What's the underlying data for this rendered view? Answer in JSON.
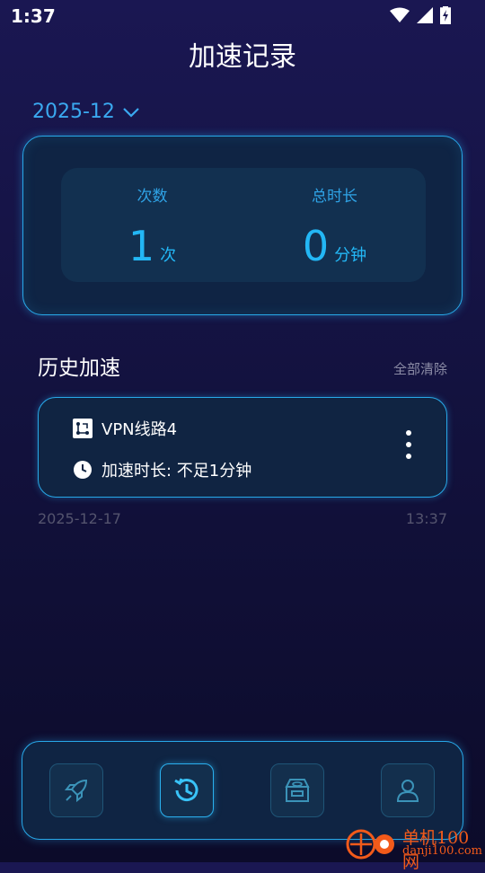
{
  "status_bar": {
    "time": "1:37",
    "icons": [
      "wifi-icon",
      "signal-icon",
      "battery-charging-icon"
    ]
  },
  "header": {
    "title": "加速记录"
  },
  "month_selector": {
    "value": "2025-12",
    "icon": "chevron-down-icon"
  },
  "stats": {
    "count_label": "次数",
    "count_value": "1",
    "count_unit": "次",
    "duration_label": "总时长",
    "duration_value": "0",
    "duration_unit": "分钟"
  },
  "history": {
    "title": "历史加速",
    "clear_label": "全部清除",
    "records": [
      {
        "line_name": "VPN线路4",
        "duration_text": "加速时长: 不足1分钟",
        "date": "2025-12-17",
        "time": "13:37"
      }
    ]
  },
  "nav": {
    "items": [
      {
        "icon": "rocket-icon",
        "active": false
      },
      {
        "icon": "history-icon",
        "active": true
      },
      {
        "icon": "box-icon",
        "active": false
      },
      {
        "icon": "profile-icon",
        "active": false
      }
    ]
  },
  "watermark": {
    "line1": "单机100网",
    "line2": "danji100.com"
  },
  "colors": {
    "accent": "#28a8e8",
    "stat_text": "#23b7f5",
    "background_top": "#1a1752",
    "background_bottom": "#0c0b2a",
    "watermark": "#f25a1a"
  }
}
